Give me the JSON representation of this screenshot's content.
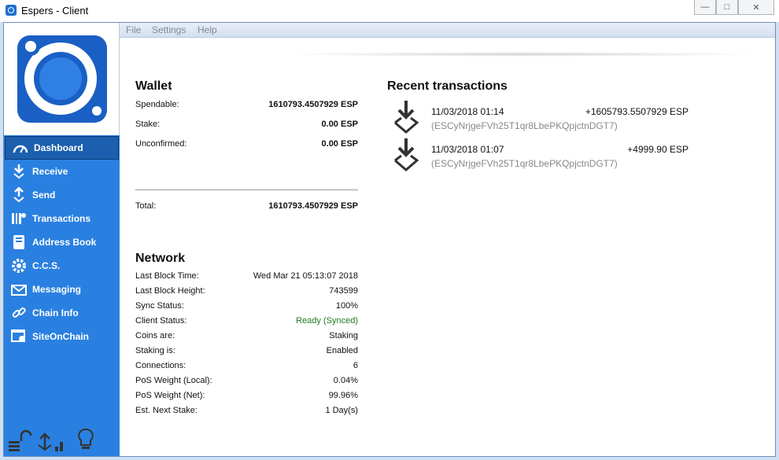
{
  "window": {
    "title": "Espers - Client"
  },
  "menu": [
    "File",
    "Settings",
    "Help"
  ],
  "sidebar": {
    "items": [
      {
        "label": "Dashboard",
        "icon": "gauge-icon"
      },
      {
        "label": "Receive",
        "icon": "receive-icon"
      },
      {
        "label": "Send",
        "icon": "send-icon"
      },
      {
        "label": "Transactions",
        "icon": "transactions-icon"
      },
      {
        "label": "Address Book",
        "icon": "address-book-icon"
      },
      {
        "label": "C.C.S.",
        "icon": "gear-icon"
      },
      {
        "label": "Messaging",
        "icon": "envelope-icon"
      },
      {
        "label": "Chain Info",
        "icon": "chain-icon"
      },
      {
        "label": "SiteOnChain",
        "icon": "site-icon"
      }
    ]
  },
  "wallet": {
    "heading": "Wallet",
    "spendable_label": "Spendable:",
    "spendable_value": "1610793.4507929 ESP",
    "stake_label": "Stake:",
    "stake_value": "0.00 ESP",
    "unconfirmed_label": "Unconfirmed:",
    "unconfirmed_value": "0.00 ESP",
    "total_label": "Total:",
    "total_value": "1610793.4507929 ESP"
  },
  "network": {
    "heading": "Network",
    "rows": [
      {
        "label": "Last Block Time:",
        "value": "Wed Mar 21 05:13:07 2018"
      },
      {
        "label": "Last Block Height:",
        "value": "743599"
      },
      {
        "label": "Sync Status:",
        "value": "100%"
      },
      {
        "label": "Client Status:",
        "value": "Ready (Synced)"
      },
      {
        "label": "Coins are:",
        "value": "Staking"
      },
      {
        "label": "Staking is:",
        "value": "Enabled"
      },
      {
        "label": "Connections:",
        "value": "6"
      },
      {
        "label": "PoS Weight (Local):",
        "value": "0.04%"
      },
      {
        "label": "PoS Weight (Net):",
        "value": "99.96%"
      },
      {
        "label": "Est. Next Stake:",
        "value": "1 Day(s)"
      }
    ]
  },
  "recent": {
    "heading": "Recent transactions",
    "items": [
      {
        "date": "11/03/2018 01:14",
        "amount": "+1605793.5507929 ESP",
        "address": "(ESCyNrjgeFVh25T1qr8LbePKQpjctnDGT7)"
      },
      {
        "date": "11/03/2018 01:07",
        "amount": "+4999.90 ESP",
        "address": "(ESCyNrjgeFVh25T1qr8LbePKQpjctnDGT7)"
      }
    ]
  },
  "colors": {
    "sidebar": "#2a80e0",
    "active": "#1b5fae",
    "status_green": "#1f7a1f"
  }
}
